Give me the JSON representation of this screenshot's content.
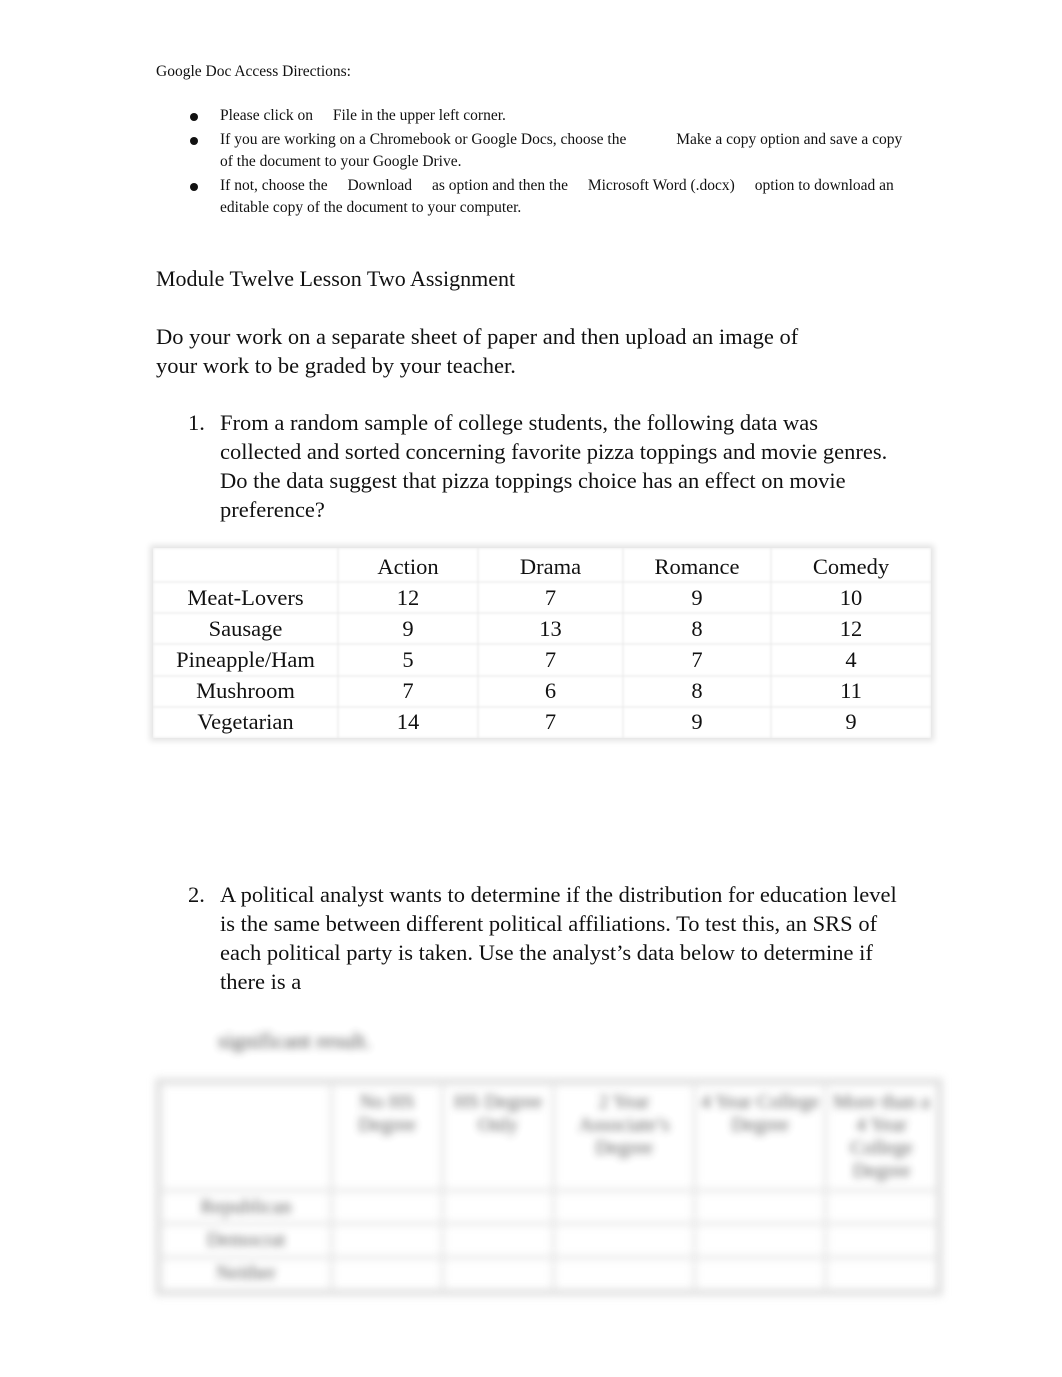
{
  "directions": {
    "heading": "Google Doc Access Directions:",
    "bullets": [
      {
        "pre": "Please click on",
        "emph": "File",
        "post": "in the upper left corner."
      },
      {
        "pre": "If you are working on a Chromebook or Google Docs, choose the",
        "emph": "Make a copy option",
        "post": "and save a copy of the document to your Google Drive."
      },
      {
        "pre": "If not, choose the",
        "emph": "Download",
        "mid": "as option and then the",
        "emph2": "Microsoft Word (.docx)",
        "post": "option to download an editable copy of the document to your computer."
      }
    ]
  },
  "assignment": {
    "title": "Module Twelve Lesson Two Assignment",
    "instructions": "Do your work on a separate sheet of paper and then upload an image of your work to be graded by your teacher.",
    "questions": [
      {
        "number": "1.",
        "text": "From a random sample of college students, the following data was collected and sorted concerning favorite pizza toppings and movie genres. Do the data suggest that pizza toppings choice has an effect on movie preference?"
      },
      {
        "number": "2.",
        "text": "A political analyst wants to determine if the distribution for education level is the same between different political affiliations. To test this, an SRS of each political party is taken. Use the analyst’s data below to determine if there is a"
      }
    ]
  },
  "table1": {
    "columns": [
      "",
      "Action",
      "Drama",
      "Romance",
      "Comedy"
    ],
    "rows": [
      {
        "label": "Meat-Lovers",
        "values": [
          "12",
          "7",
          "9",
          "10"
        ]
      },
      {
        "label": "Sausage",
        "values": [
          "9",
          "13",
          "8",
          "12"
        ]
      },
      {
        "label": "Pineapple/Ham",
        "values": [
          "5",
          "7",
          "7",
          "4"
        ]
      },
      {
        "label": "Mushroom",
        "values": [
          "7",
          "6",
          "8",
          "11"
        ]
      },
      {
        "label": "Vegetarian",
        "values": [
          "14",
          "7",
          "9",
          "9"
        ]
      }
    ]
  },
  "blurred_section": {
    "caption": "significant result.",
    "columns": [
      "",
      "No HS Degree",
      "HS Degree Only",
      "2 Year Associate’s Degree",
      "4 Year College Degree",
      "More than a 4 Year College Degree"
    ],
    "rows": [
      "Republican",
      "Democrat",
      "Neither"
    ]
  }
}
